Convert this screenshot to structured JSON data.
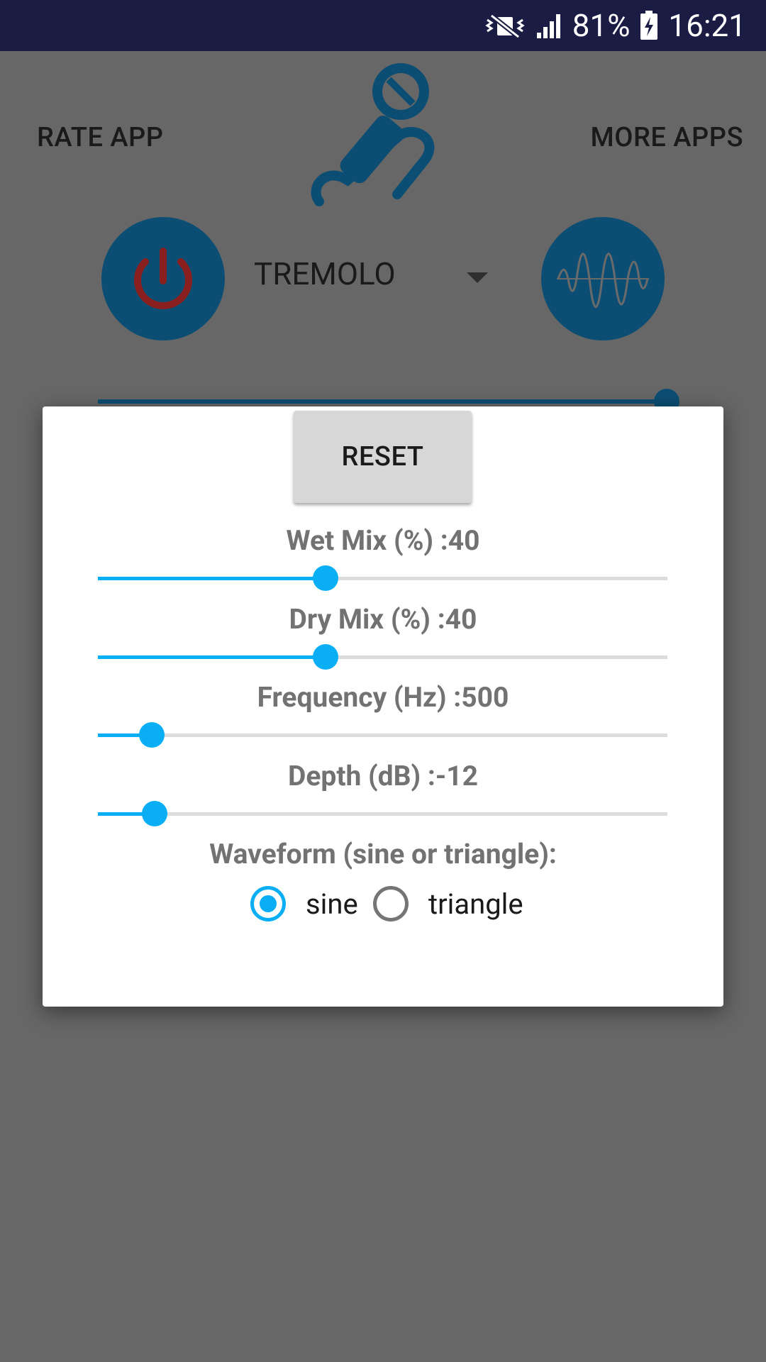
{
  "status_bar": {
    "battery": "81%",
    "time": "16:21",
    "icons": [
      "mute-vibrate-icon",
      "signal-icon",
      "battery-charging-icon"
    ]
  },
  "header": {
    "rate_app": "RATE APP",
    "more_apps": "MORE APPS",
    "logo_icon": "microphone-icon"
  },
  "controls": {
    "power_icon": "power-icon",
    "effect": "TREMOLO",
    "waveform_icon": "waveform-icon",
    "background_slider_value": 1.0
  },
  "dialog": {
    "reset_label": "RESET",
    "params": [
      {
        "label": "Wet Mix (%) :40",
        "value": 40,
        "min": 0,
        "max": 100
      },
      {
        "label": "Dry Mix (%) :40",
        "value": 40,
        "min": 0,
        "max": 100
      },
      {
        "label": "Frequency (Hz) :500",
        "value": 0.095
      },
      {
        "label": "Depth (dB) :-12",
        "value": 0.1
      }
    ],
    "waveform_label": "Waveform (sine or triangle):",
    "options": [
      {
        "label": "sine",
        "checked": true
      },
      {
        "label": "triangle",
        "checked": false
      }
    ]
  },
  "colors": {
    "accent": "#0aaef5",
    "status_bar": "#1a1c43",
    "dim_background": "#676767",
    "button_blue": "#0c4e73",
    "power_red": "#8a1f1f"
  }
}
